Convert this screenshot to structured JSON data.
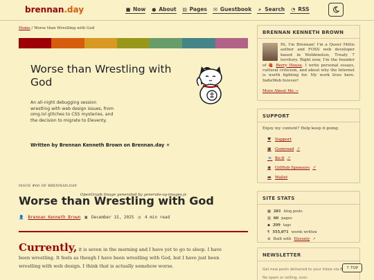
{
  "site": {
    "brand": "brennan.day",
    "nav": [
      {
        "icon": "bookmark-icon",
        "glyph": "■",
        "label": "Now"
      },
      {
        "icon": "info-icon",
        "glyph": "●",
        "label": "About"
      },
      {
        "icon": "pages-icon",
        "glyph": "▤",
        "label": "Pages"
      },
      {
        "icon": "guestbook-icon",
        "glyph": "✉",
        "label": "Guestbook"
      },
      {
        "icon": "search-icon",
        "glyph": "⌕",
        "label": "Search"
      },
      {
        "icon": "rss-icon",
        "glyph": "◔",
        "label": "RSS"
      }
    ],
    "theme_toggle_icon": "moon-icon"
  },
  "breadcrumb": {
    "home": "Home",
    "separator": "/",
    "current": "Worse than Wrestling with God"
  },
  "stripe_colors": [
    "#9d0006",
    "#d65d0e",
    "#d79921",
    "#98971a",
    "#689d6a",
    "#458588",
    "#b16286"
  ],
  "og": {
    "title": "Worse than Wrestling with God",
    "description": "An all-night debugging session wrestling with web design issues, from omg.lol glitches to CSS mysteries, and the decision to migrate to Eleventy.",
    "author_line": "Written by Brennan Kenneth Brown on Brennan.day",
    "caption": "OpenGraph Image generated by generate-og-images.js"
  },
  "post": {
    "issue": "ISSUE #60 OF BRENNAN.DAY",
    "title": "Worse than Wrestling with God",
    "author": "Brennan Kenneth Brown",
    "date": "December 15, 2025",
    "read_time": "4 min read",
    "lead_word": "Currently,",
    "lead_text": " it is seven in the morning and I have yet to go to sleep. I have been wrestling. It feels as though I have been wrestling with God, but I have just been wrestling with web design. I think that is actually somehow worse."
  },
  "sidebar": {
    "about": {
      "heading": "BRENNAN KENNETH BROWN",
      "bio_start": "Hi, I'm Brennan! I'm a Queer Métis author and FOSS web developer based in Mohkinstsis, Treaty 7 territory. Right now, I'm the founder of ",
      "berry_link": "Berry House",
      "bio_end": ". I write personal essays, cultural criticism, and about why the Internet is worth fighting for. My work lives here. IndieWeb forever!",
      "more_link": "More About Me →"
    },
    "support": {
      "heading": "SUPPORT",
      "intro": "Enjoy my content? Help keep it going:",
      "links": [
        {
          "icon": "gift-icon",
          "glyph": "♥",
          "label": "Support"
        },
        {
          "icon": "cart-icon",
          "glyph": "▣",
          "label": "Gumroad"
        },
        {
          "icon": "coffee-icon",
          "glyph": "☕",
          "label": "Ko-fi"
        },
        {
          "icon": "github-icon",
          "glyph": "◉",
          "label": "GitHub Sponsors"
        },
        {
          "icon": "wallet-icon",
          "glyph": "▬",
          "label": "Wallet"
        }
      ]
    },
    "stats": {
      "heading": "SITE STATS",
      "rows": [
        {
          "icon": "post-icon",
          "glyph": "▦",
          "value": "281",
          "label": "blog posts"
        },
        {
          "icon": "page-icon",
          "glyph": "▥",
          "value": "60",
          "label": "pages"
        },
        {
          "icon": "tag-icon",
          "glyph": "◆",
          "value": "299",
          "label": "tags"
        },
        {
          "icon": "words-icon",
          "glyph": "¶",
          "value": "555,071",
          "label": "words written"
        }
      ],
      "built_label": "Built with",
      "built_link": "Eleventy"
    },
    "newsletter": {
      "heading": "NEWSLETTER",
      "line1": "Get new posts delivered to your inbox via Buttondown.",
      "line2": "No spam or selling, ever."
    }
  },
  "top_button": "↑ TOP"
}
